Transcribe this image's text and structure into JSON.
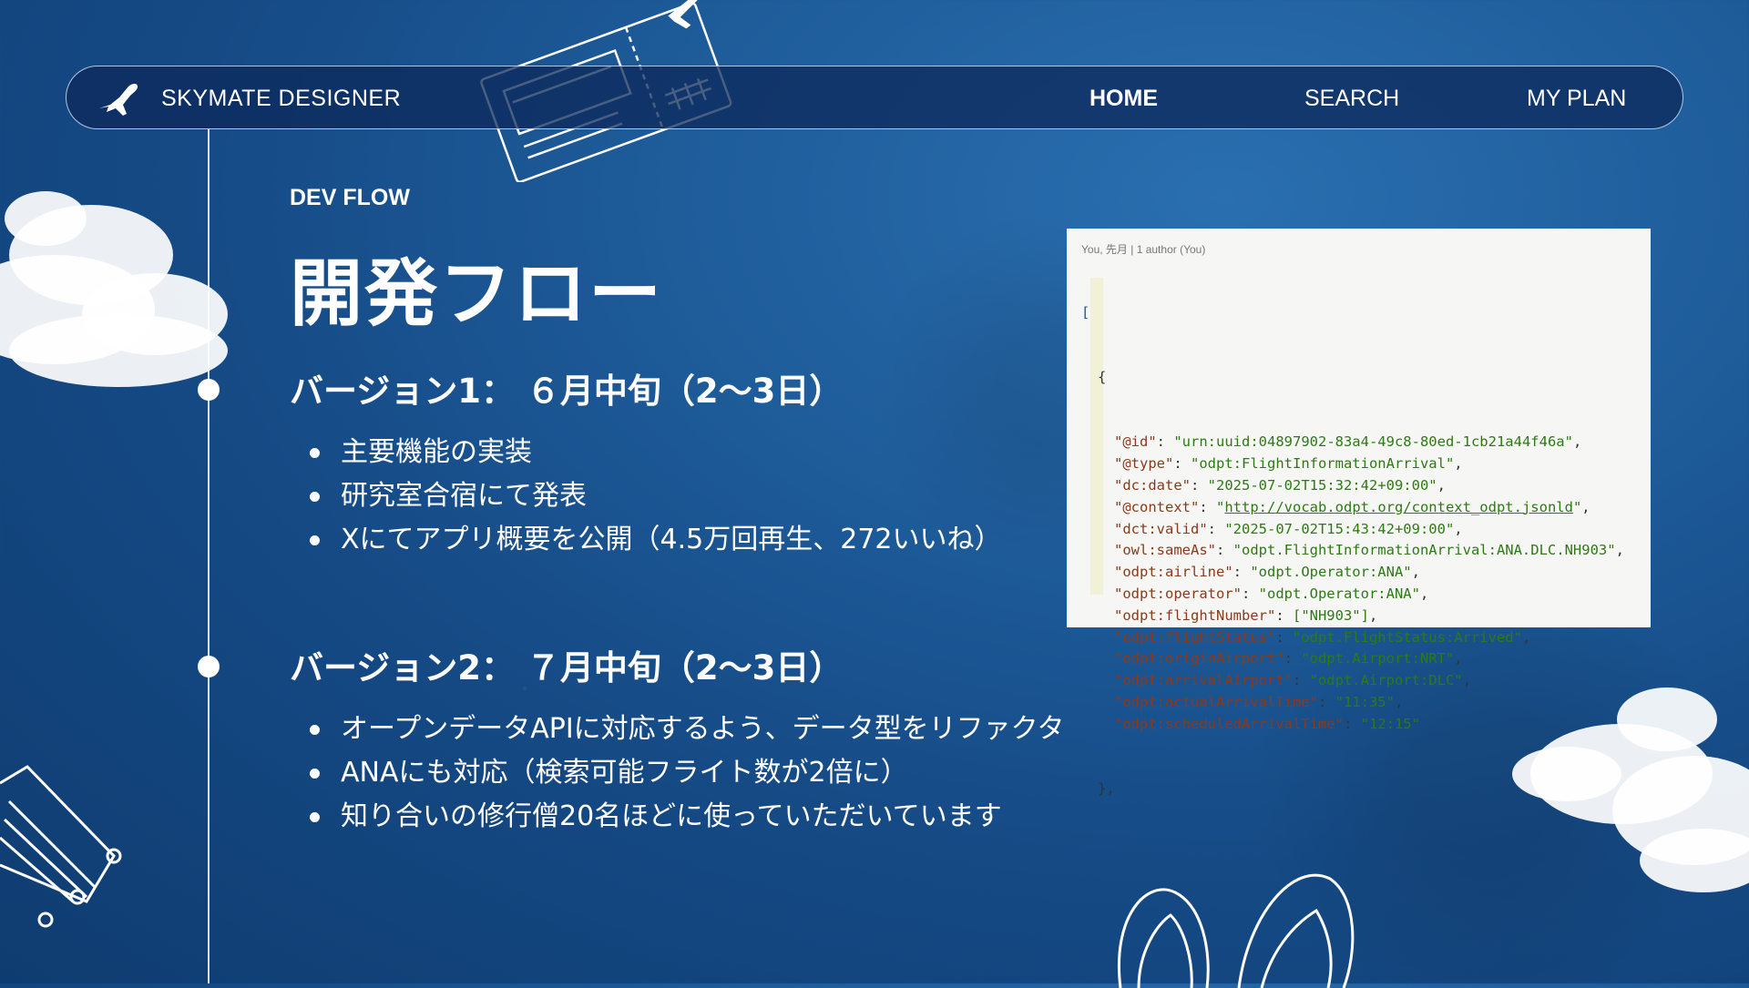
{
  "nav": {
    "brand": "SKYMATE DESIGNER",
    "links": [
      {
        "label": "HOME",
        "active": true
      },
      {
        "label": "SEARCH",
        "active": false
      },
      {
        "label": "MY PLAN",
        "active": false
      }
    ]
  },
  "section": {
    "eyebrow": "DEV FLOW",
    "title": "開発フロー"
  },
  "versions": [
    {
      "heading": "バージョン1： ６月中旬（2〜3日）",
      "items": [
        "主要機能の実装",
        "研究室合宿にて発表",
        "Xにてアプリ概要を公開（4.5万回再生、272いいね）"
      ]
    },
    {
      "heading": "バージョン2： ７月中旬（2〜3日）",
      "items": [
        "オープンデータAPIに対応するよう、データ型をリファクタ",
        "ANAにも対応（検索可能フライト数が2倍に）",
        "知り合いの修行僧20名ほどに使っていただいています"
      ]
    }
  ],
  "code": {
    "header": "You, 先月 | 1 author (You)",
    "open_bracket": "[",
    "open_brace": "{",
    "close_brace": "},",
    "entries": [
      {
        "key": "\"@id\"",
        "value": "\"urn:uuid:04897902-83a4-49c8-80ed-1cb21a44f46a\"",
        "tail": ","
      },
      {
        "key": "\"@type\"",
        "value": "\"odpt:FlightInformationArrival\"",
        "tail": ","
      },
      {
        "key": "\"dc:date\"",
        "value": "\"2025-07-02T15:32:42+09:00\"",
        "tail": ","
      },
      {
        "key": "\"@context\"",
        "value_prefix": "\"",
        "link": "http://vocab.odpt.org/context_odpt.jsonld",
        "value_suffix": "\"",
        "tail": ","
      },
      {
        "key": "\"dct:valid\"",
        "value": "\"2025-07-02T15:43:42+09:00\"",
        "tail": ","
      },
      {
        "key": "\"owl:sameAs\"",
        "value": "\"odpt.FlightInformationArrival:ANA.DLC.NH903\"",
        "tail": ","
      },
      {
        "key": "\"odpt:airline\"",
        "value": "\"odpt.Operator:ANA\"",
        "tail": ","
      },
      {
        "key": "\"odpt:operator\"",
        "value": "\"odpt.Operator:ANA\"",
        "tail": ","
      },
      {
        "key": "\"odpt:flightNumber\"",
        "value": "[\"NH903\"]",
        "tail": ","
      },
      {
        "key": "\"odpt:flightStatus\"",
        "value": "\"odpt.FlightStatus:Arrived\"",
        "tail": ","
      },
      {
        "key": "\"odpt:originAirport\"",
        "value": "\"odpt.Airport:NRT\"",
        "tail": ","
      },
      {
        "key": "\"odpt:arrivalAirport\"",
        "value": "\"odpt.Airport:DLC\"",
        "tail": ","
      },
      {
        "key": "\"odpt:actualArrivalTime\"",
        "value": "\"11:35\"",
        "tail": ","
      },
      {
        "key": "\"odpt:scheduledArrivalTime\"",
        "value": "\"12:15\"",
        "tail": ""
      }
    ]
  },
  "decorations": [
    "ticket-icon",
    "cloud",
    "suitcase-icon",
    "flip-flops-icon"
  ]
}
